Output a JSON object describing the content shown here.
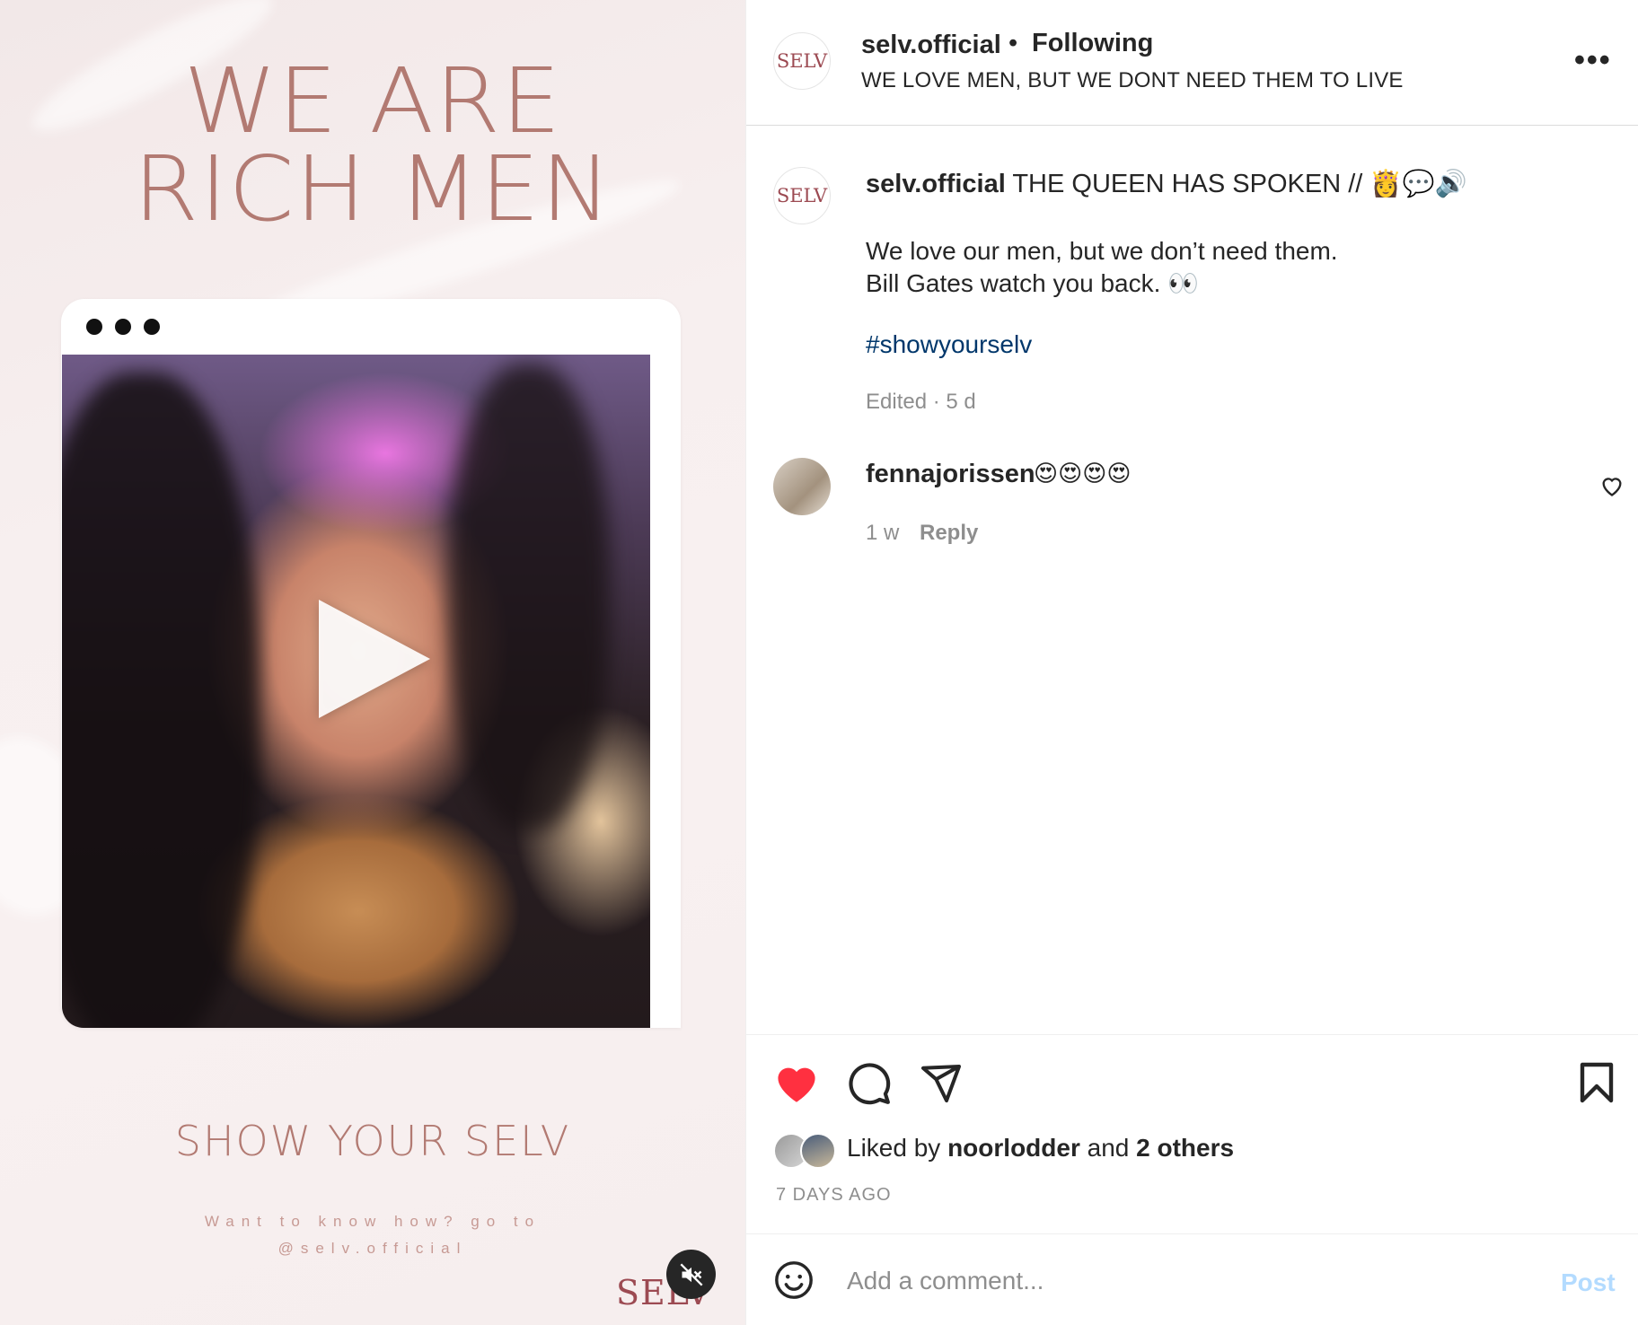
{
  "media": {
    "headline_line1": "WE ARE",
    "headline_line2": "RICH MEN",
    "tagline": "SHOW YOUR SELV",
    "instruction_line1": "Want to know how? go to",
    "instruction_line2": "@selv.official",
    "logo_text": "SELV",
    "mute_icon": "speaker-muted-icon",
    "play_icon": "play-icon",
    "accent_color": "#b27a72"
  },
  "header": {
    "avatar_text": "SELV",
    "username": "selv.official",
    "separator": "•",
    "follow_status": "Following",
    "subtitle": "WE LOVE MEN, BUT WE DONT NEED THEM TO LIVE",
    "more_label": "•••"
  },
  "caption": {
    "avatar_text": "SELV",
    "username": "selv.official",
    "text": " THE QUEEN HAS SPOKEN // 👸💬🔊",
    "line2": "We love our men, but we don’t need them.",
    "line3": "Bill Gates watch you back. 👀",
    "hashtag": "#showyourselv",
    "meta": "Edited · 5 d"
  },
  "comments": [
    {
      "username": "fennajorissen",
      "text": "😍😍😍😍",
      "time": "1 w",
      "reply_label": "Reply"
    }
  ],
  "actions": {
    "like_icon": "heart-filled-icon",
    "comment_icon": "comment-bubble-icon",
    "share_icon": "paper-plane-icon",
    "save_icon": "bookmark-icon",
    "like_color": "#ff3040"
  },
  "likes": {
    "prefix": "Liked by ",
    "user": "noorlodder",
    "middle": " and ",
    "others": "2 others"
  },
  "timestamp": "7 DAYS AGO",
  "comment_box": {
    "placeholder": "Add a comment...",
    "post_label": "Post"
  }
}
